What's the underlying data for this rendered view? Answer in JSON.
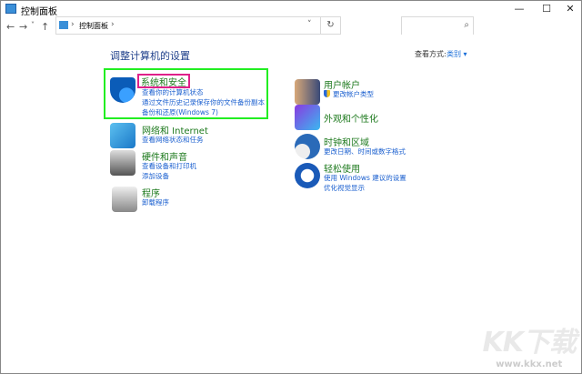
{
  "window": {
    "title": "控制面板",
    "minimize": "—",
    "maximize": "☐",
    "close": "✕"
  },
  "nav": {
    "back": "←",
    "forward": "→",
    "recent": "˅",
    "up": "↑"
  },
  "address": {
    "crumb": "控制面板",
    "sep": "›",
    "sep2": "›",
    "dropdown": "˅",
    "refresh": "↻"
  },
  "search": {
    "placeholder": "",
    "icon": "⌕"
  },
  "main": {
    "heading": "调整计算机的设置",
    "view_by_label": "查看方式:",
    "view_by_value": "类别 ▾"
  },
  "categories_left": [
    {
      "title": "系统和安全",
      "links": [
        "查看你的计算机状态",
        "通过文件历史记录保存你的文件备份副本",
        "备份和还原(Windows 7)"
      ]
    },
    {
      "title": "网络和 Internet",
      "links": [
        "查看网络状态和任务"
      ]
    },
    {
      "title": "硬件和声音",
      "links": [
        "查看设备和打印机",
        "添加设备"
      ]
    },
    {
      "title": "程序",
      "links": [
        "卸载程序"
      ]
    }
  ],
  "categories_right": [
    {
      "title": "用户帐户",
      "links": [
        "更改帐户类型"
      ]
    },
    {
      "title": "外观和个性化",
      "links": []
    },
    {
      "title": "时钟和区域",
      "links": [
        "更改日期、时间或数字格式"
      ]
    },
    {
      "title": "轻松使用",
      "links": [
        "使用 Windows 建议的设置",
        "优化视觉显示"
      ]
    }
  ],
  "watermark": {
    "logo": "KK下载",
    "url": "www.kkx.net"
  },
  "colors": {
    "category": "#1e7a1e",
    "link": "#1a5fcf",
    "highlight_green": "#22ee22",
    "highlight_pink": "#e0208a"
  }
}
